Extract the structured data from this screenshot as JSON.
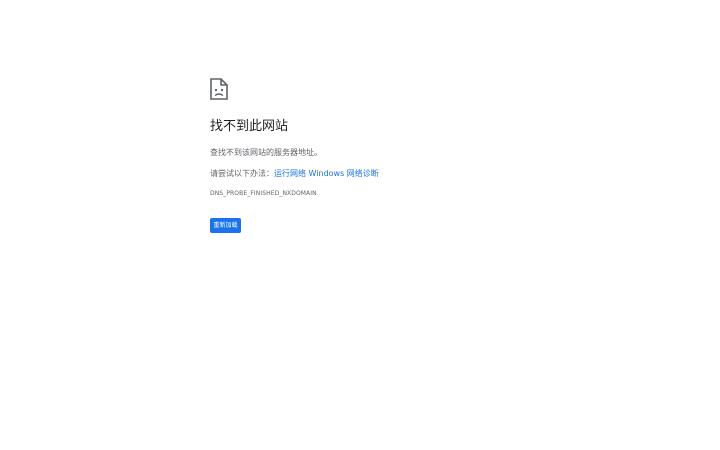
{
  "error_page": {
    "icon": "sad-document-icon",
    "title": "找不到此网站",
    "description": "查找不到该网站的服务器地址。",
    "hint_prefix": "请尝试以下办法：",
    "hint_link": "运行网络 Windows 网络诊断",
    "error_code": "DNS_PROBE_FINISHED_NXDOMAIN",
    "reload_label": "重新加载"
  },
  "colors": {
    "accent": "#1a73e8",
    "title_text": "#202124",
    "secondary_text": "#5f6368",
    "background": "#ffffff"
  }
}
